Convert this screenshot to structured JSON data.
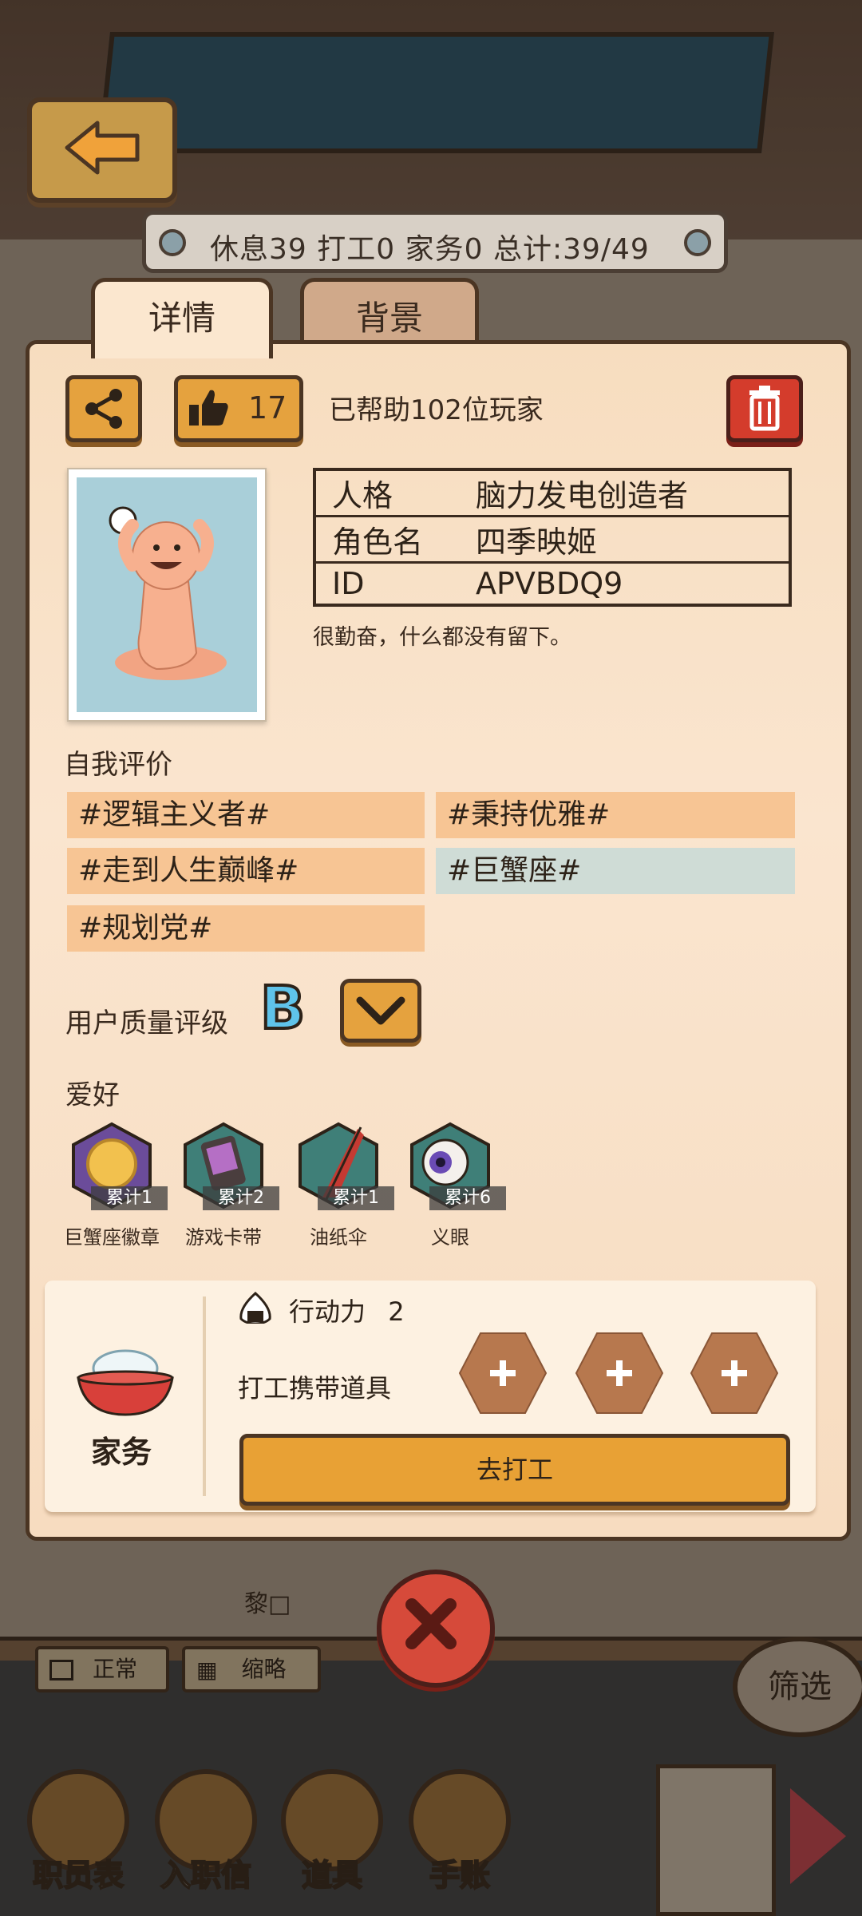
{
  "header": {
    "stat_bar": "休息39 打工0 家务0 总计:39/49"
  },
  "tabs": [
    {
      "label": "详情",
      "active": true
    },
    {
      "label": "背景",
      "active": false
    }
  ],
  "toolbar": {
    "like_count": "17",
    "helped_text": "已帮助102位玩家"
  },
  "profile": {
    "rows": [
      {
        "key": "人格",
        "value": "脑力发电创造者"
      },
      {
        "key": "角色名",
        "value": "四季映姬"
      },
      {
        "key": "ID",
        "value": "APVBDQ9"
      }
    ],
    "description": "很勤奋，什么都没有留下。"
  },
  "self_eval": {
    "label": "自我评价",
    "tags": [
      {
        "text": "#逻辑主义者#",
        "color": "#f7c594"
      },
      {
        "text": "#秉持优雅#",
        "color": "#f7c594"
      },
      {
        "text": "#走到人生巅峰#",
        "color": "#f7c594"
      },
      {
        "text": "#巨蟹座#",
        "color": "#cfdcd6"
      },
      {
        "text": "#规划党#",
        "color": "#f7c594"
      }
    ]
  },
  "quality": {
    "label": "用户质量评级",
    "grade": "B"
  },
  "hobbies": {
    "label": "爱好",
    "items": [
      {
        "name": "巨蟹座徽章",
        "count": "累计1",
        "icon": "crab-badge-icon"
      },
      {
        "name": "游戏卡带",
        "count": "累计2",
        "icon": "game-cartridge-icon"
      },
      {
        "name": "油纸伞",
        "count": "累计1",
        "icon": "paper-umbrella-icon"
      },
      {
        "name": "义眼",
        "count": "累计6",
        "icon": "prosthetic-eye-icon"
      }
    ]
  },
  "task": {
    "name": "家务",
    "energy_label": "行动力",
    "energy_value": "2",
    "carry_label": "打工携带道具",
    "work_button": "去打工"
  },
  "scene": {
    "pot_label": "黎□",
    "normal_label": "正常",
    "thumb_label": "缩略",
    "filter_label": "筛选"
  },
  "bottom_nav": [
    {
      "label": "职员表",
      "icon": "paw-icon"
    },
    {
      "label": "入职信",
      "icon": "letter-icon"
    },
    {
      "label": "道具",
      "icon": "wrench-icon"
    },
    {
      "label": "手账",
      "icon": "notebook-icon"
    }
  ],
  "colors": {
    "accent": "#e5a23e",
    "danger": "#d43c2c",
    "card": "#fae5cf"
  }
}
